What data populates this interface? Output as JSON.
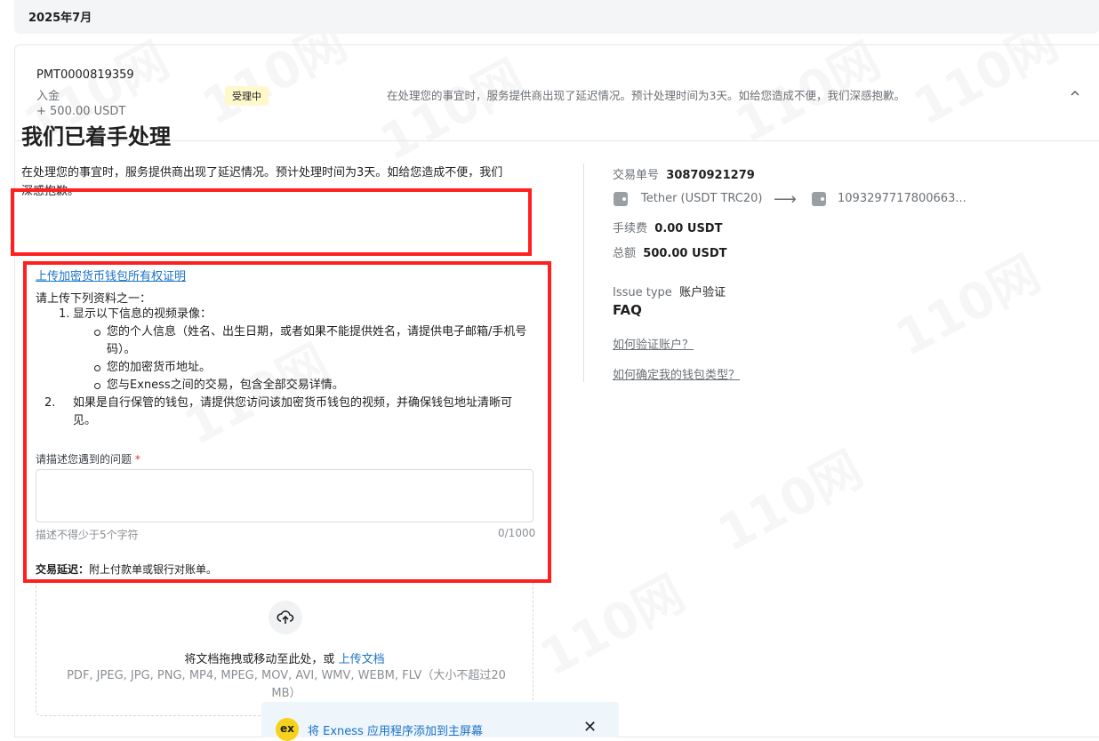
{
  "header": {
    "month": "2025年7月"
  },
  "payment": {
    "id": "PMT0000819359",
    "type": "入金",
    "amount": "+ 500.00 USDT",
    "status": "受理中",
    "message": "在处理您的事宜时，服务提供商出现了延迟情况。预计处理时间为3天。如给您造成不便，我们深感抱歉。"
  },
  "main": {
    "heading": "我们已着手处理",
    "intro": "在处理您的事宜时，服务提供商出现了延迟情况。预计处理时间为3天。如给您造成不便，我们深感抱歉。",
    "upload_title": "上传加密货币钱包所有权证明",
    "requirement_intro": "请上传下列资料之一：",
    "item1_num": "1.",
    "item1": "显示以下信息的视频录像：",
    "sub1": "您的个人信息（姓名、出生日期，或者如果不能提供姓名，请提供电子邮箱/手机号码）。",
    "sub2": "您的加密货币地址。",
    "sub3": "您与Exness之间的交易，包含全部交易详情。",
    "item2_num": "2.",
    "item2": "如果是自行保管的钱包，请提供您访问该加密货币钱包的视频，并确保钱包地址清晰可见。",
    "field_label": "请描述您遇到的问题",
    "required_mark": "*",
    "hint": "描述不得少于5个字符",
    "counter": "0/1000",
    "delay_title": "交易延迟：",
    "delay_text": "附上付款单或银行对账单。",
    "drop_text": "将文档拖拽或移动至此处，或 ",
    "drop_link": "上传文档",
    "formats": "PDF, JPEG, JPG, PNG, MP4, MPEG, MOV, AVI, WMV, WEBM, FLV（大小不超过20 MB）"
  },
  "side": {
    "txn_label": "交易单号",
    "txn_value": "30870921279",
    "from": "Tether (USDT TRC20)",
    "arrow": "⟶",
    "to": "1093297717800663...",
    "fee_label": "手续费",
    "fee_value": "0.00 USDT",
    "total_label": "总额",
    "total_value": "500.00 USDT",
    "issue_label": "Issue type",
    "issue_value": "账户验证",
    "faq_title": "FAQ",
    "faq1": "如何验证账户？",
    "faq2": "如何确定我的钱包类型？"
  },
  "banner": {
    "logo": "ex",
    "text": "将 Exness 应用程序添加到主屏幕",
    "close": "✕"
  },
  "watermark": "110网"
}
